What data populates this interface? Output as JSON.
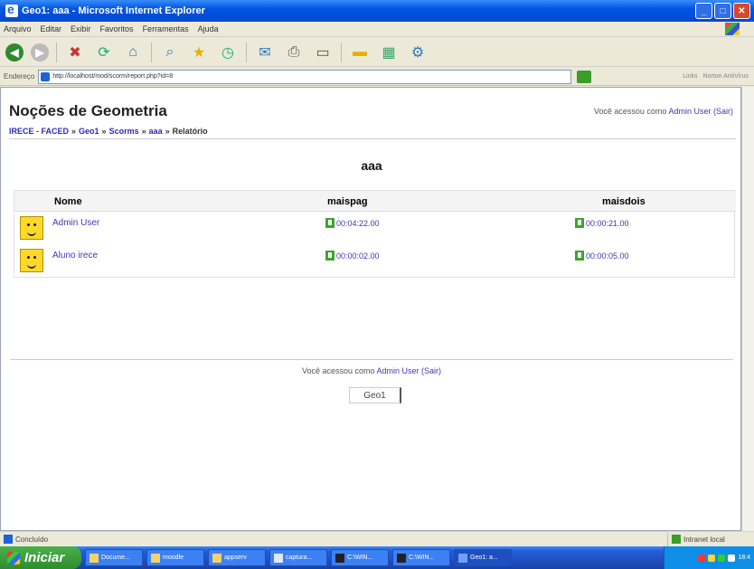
{
  "window": {
    "title": "Geo1: aaa - Microsoft Internet Explorer"
  },
  "menu": [
    "Arquivo",
    "Editar",
    "Exibir",
    "Favoritos",
    "Ferramentas",
    "Ajuda"
  ],
  "address": {
    "label": "Endereço",
    "url": "http://localhost/mod/scorm/report.php?id=8",
    "links_label": "Links",
    "search_label": "Norton AntiVirus"
  },
  "site": {
    "title": "Noções de Geometria",
    "login_prefix": "Você acessou como",
    "login_user": "Admin User",
    "login_logout": "(Sair)"
  },
  "breadcrumb": {
    "items": [
      "IRECE - FACED",
      "Geo1",
      "Scorms",
      "aaa"
    ],
    "current": "Relatório",
    "separator": "»"
  },
  "report": {
    "heading": "aaa",
    "columns": [
      "Nome",
      "maispag",
      "maisdois"
    ],
    "rows": [
      {
        "name": "Admin User",
        "maispag": "00:04:22.00",
        "maisdois": "00:00:21.00"
      },
      {
        "name": "Aluno irece",
        "maispag": "00:00:02.00",
        "maisdois": "00:00:05.00"
      }
    ]
  },
  "footer": {
    "login_prefix": "Você acessou como",
    "login_user": "Admin User",
    "login_logout": "(Sair)",
    "course_button": "Geo1"
  },
  "statusbar": {
    "status": "Concluído",
    "zone": "Intranet local"
  },
  "taskbar": {
    "start": "Iniciar",
    "tasks": [
      "Docume...",
      "moodle",
      "appserv",
      "captura...",
      "C:\\WIN...",
      "C:\\WIN...",
      "Geo1: a..."
    ],
    "clock": "18:4"
  }
}
